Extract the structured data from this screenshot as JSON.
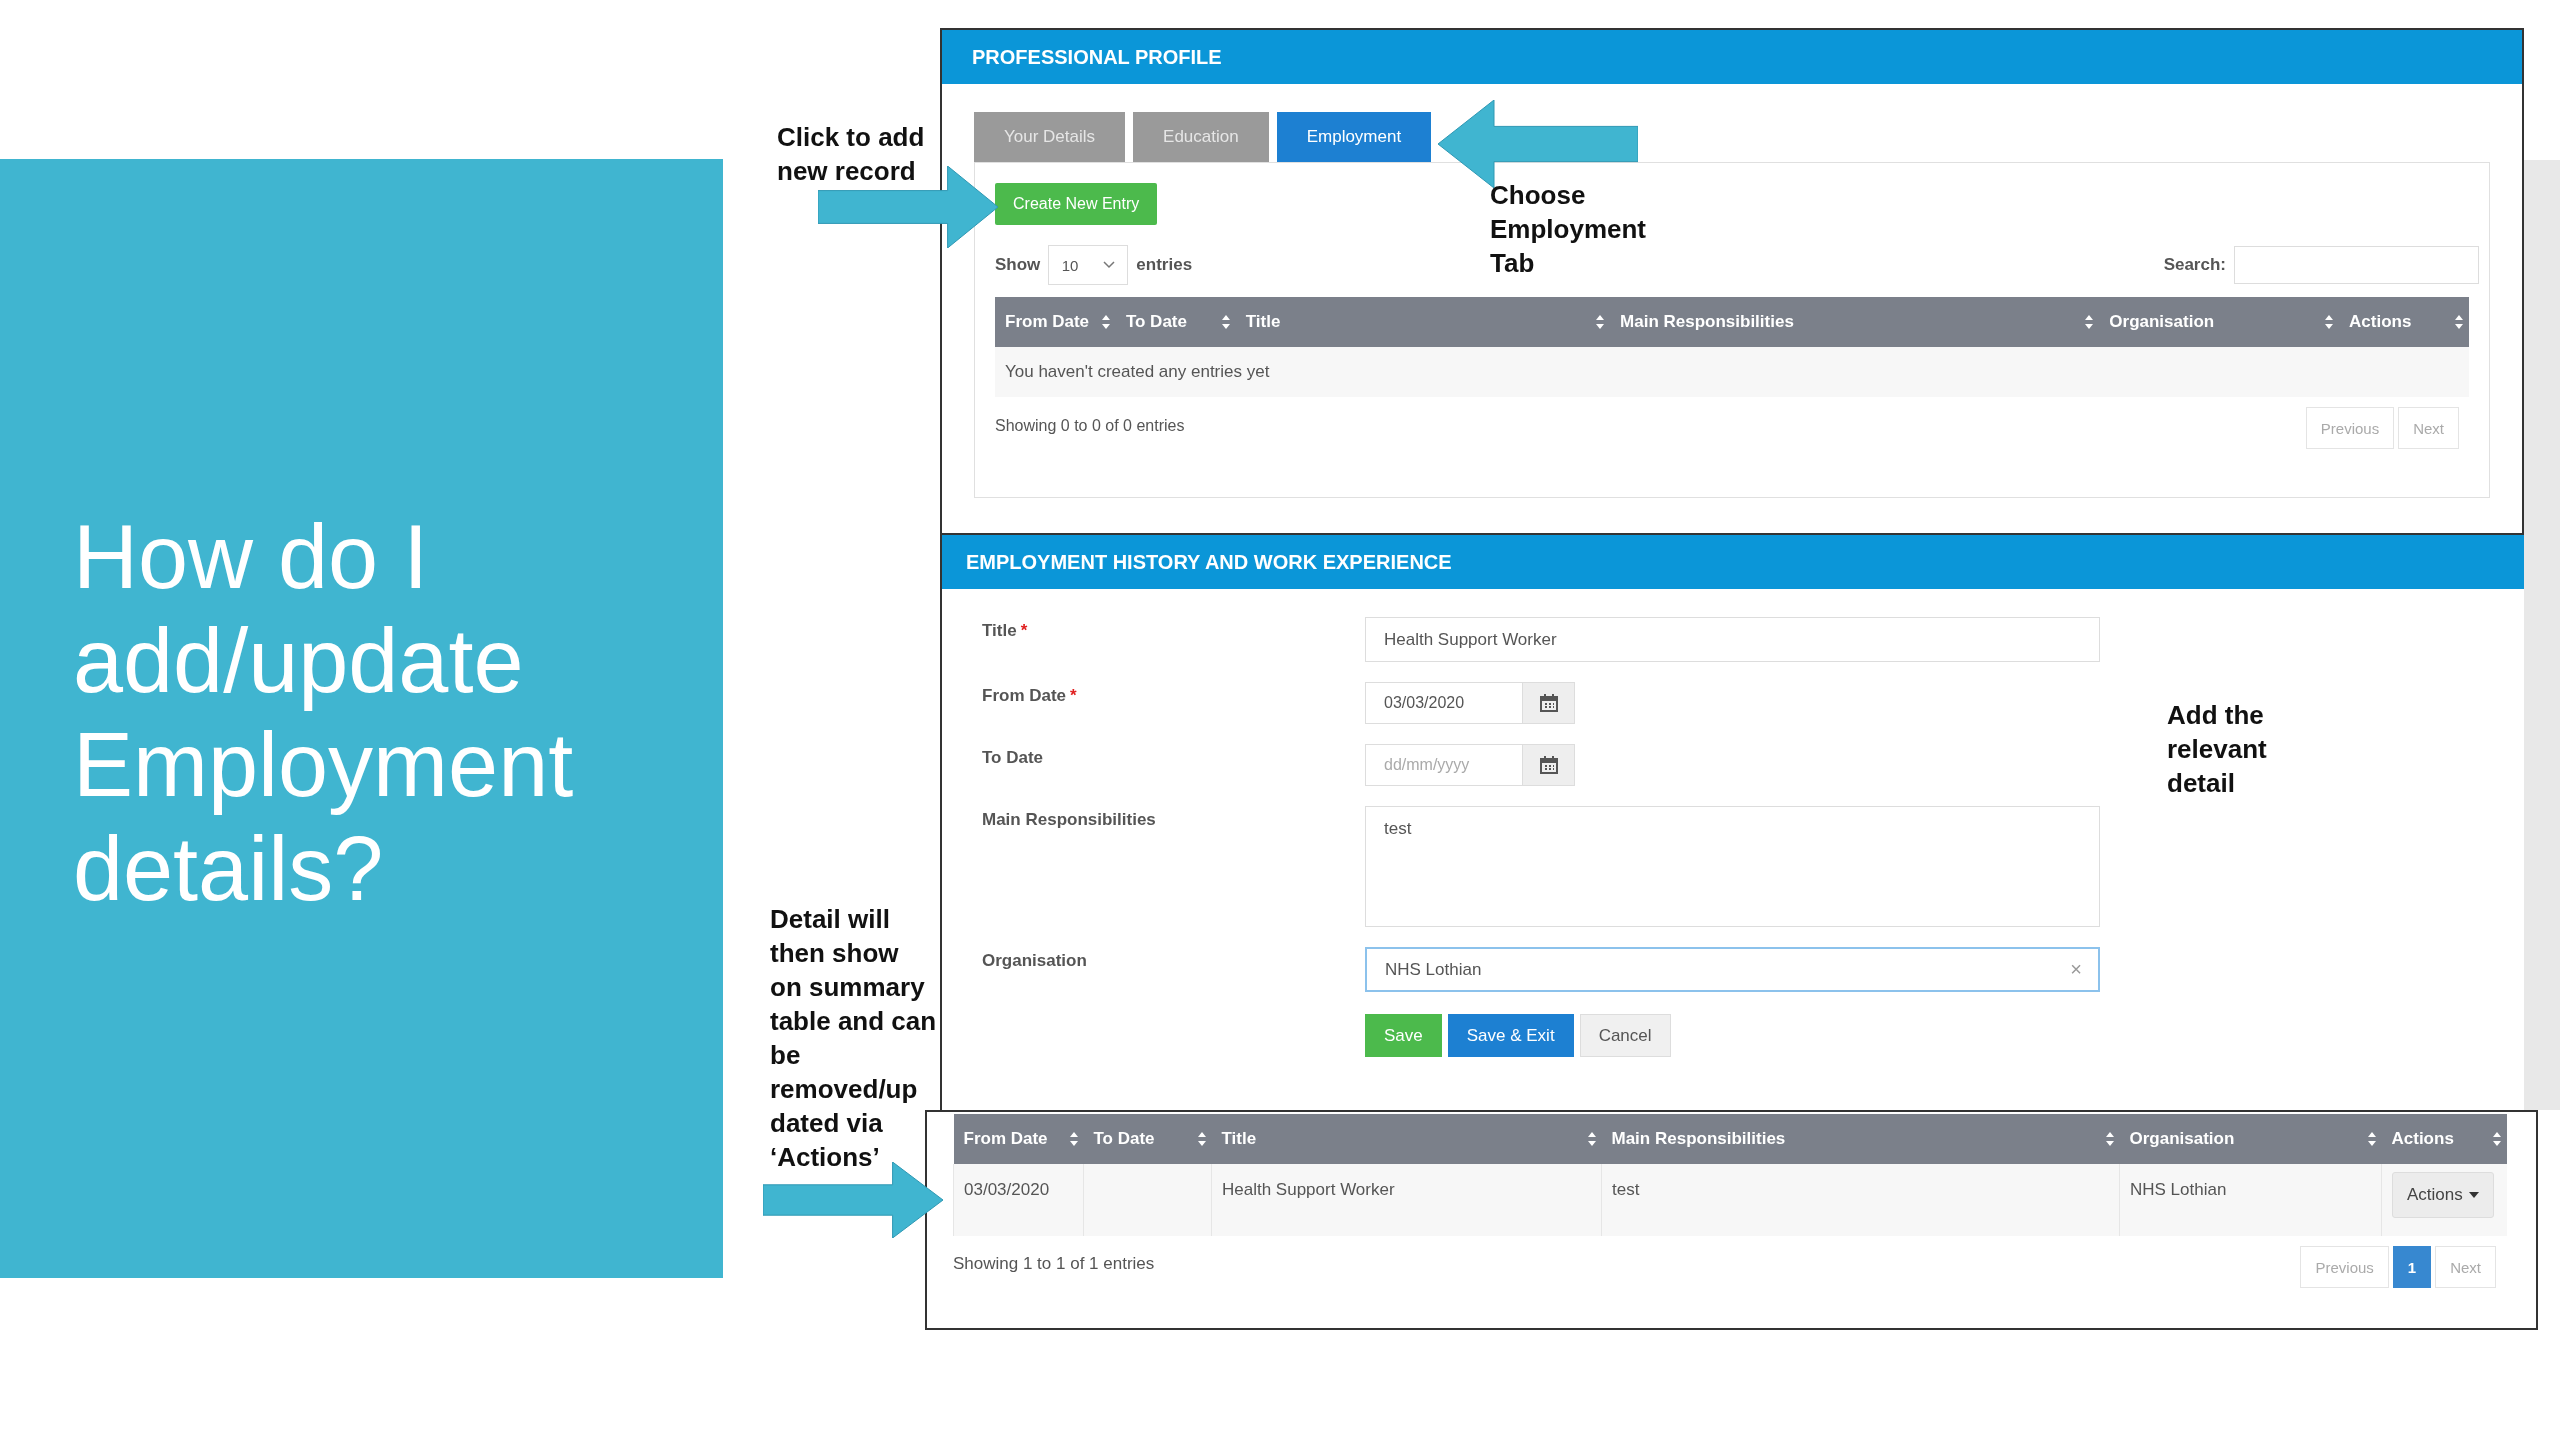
{
  "slide": {
    "title": "How do I add/update Employment details?"
  },
  "callouts": [
    {
      "lines": [
        "Click to add",
        "new record"
      ]
    },
    {
      "lines": [
        "Choose",
        "Employment",
        "Tab"
      ]
    },
    {
      "lines": [
        "Add the",
        "relevant",
        "detail"
      ]
    },
    {
      "lines": [
        "Detail will",
        "then show",
        "on summary",
        "table and can",
        "be",
        "removed/up",
        "dated via",
        "‘Actions’"
      ]
    }
  ],
  "profile_panel": {
    "title": "PROFESSIONAL PROFILE",
    "tabs": [
      {
        "label": "Your Details",
        "selected": false
      },
      {
        "label": "Education",
        "selected": false
      },
      {
        "label": "Employment",
        "selected": true
      }
    ],
    "create_button": "Create New Entry",
    "length_menu": {
      "label_before": "Show",
      "value": "10",
      "label_after": "entries"
    },
    "search": {
      "label": "Search:"
    },
    "table": {
      "columns": [
        "From Date",
        "To Date",
        "Title",
        "Main Responsibilities",
        "Organisation",
        "Actions"
      ],
      "empty_message": "You haven't created any entries yet",
      "info": "Showing 0 to 0 of 0 entries",
      "pagination": {
        "previous": "Previous",
        "next": "Next"
      }
    }
  },
  "form_panel": {
    "title": "EMPLOYMENT HISTORY AND WORK EXPERIENCE",
    "fields": [
      {
        "kind": "text",
        "label": "Title",
        "required_mark": "*",
        "value": "Health Support Worker",
        "focused": false
      },
      {
        "kind": "date",
        "label": "From Date",
        "required_mark": "*",
        "value": "03/03/2020",
        "focused": false
      },
      {
        "kind": "date",
        "label": "To Date",
        "placeholder": "dd/mm/yyyy",
        "focused": false
      },
      {
        "kind": "textarea",
        "label": "Main Responsibilities",
        "value": "test",
        "focused": false
      },
      {
        "kind": "text",
        "label": "Organisation",
        "value": "NHS Lothian",
        "focused": true,
        "clear": "×"
      }
    ],
    "buttons": [
      {
        "label": "Save",
        "kind": "success"
      },
      {
        "label": "Save & Exit",
        "kind": "primary"
      },
      {
        "label": "Cancel",
        "kind": "default"
      }
    ]
  },
  "summary_panel": {
    "table": {
      "columns": [
        "From Date",
        "To Date",
        "Title",
        "Main Responsibilities",
        "Organisation",
        "Actions"
      ],
      "rows": [
        {
          "cells": [
            "03/03/2020",
            "",
            "Health Support Worker",
            "test",
            "NHS Lothian"
          ],
          "action": "Actions"
        }
      ],
      "info": "Showing 1 to 1 of 1 entries",
      "pagination": {
        "previous": "Previous",
        "pages": [
          {
            "label": "1",
            "selected": true
          }
        ],
        "next": "Next"
      }
    }
  }
}
